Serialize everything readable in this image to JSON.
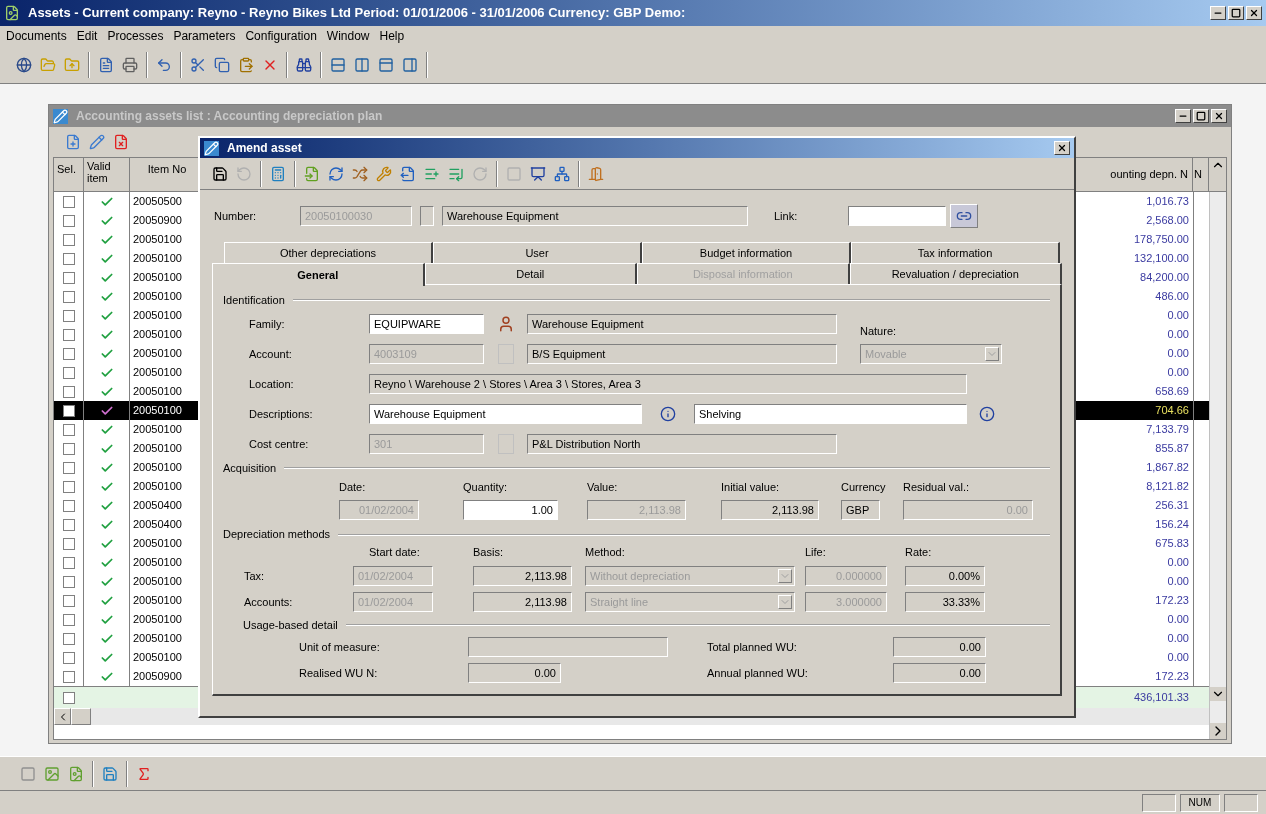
{
  "app": {
    "title": "Assets - Current company: Reyno - Reyno Bikes Ltd Period: 01/01/2006 - 31/01/2006 Currency: GBP Demo:"
  },
  "menu": [
    "Documents",
    "Edit",
    "Processes",
    "Parameters",
    "Configuration",
    "Window",
    "Help"
  ],
  "list_window": {
    "title": "Accounting assets list : Accounting depreciation plan",
    "columns": [
      "Sel.",
      "Valid item",
      "Item No",
      "ounting depn. N",
      "N"
    ],
    "rows": [
      {
        "checked": false,
        "valid": true,
        "selected": false,
        "item_no": "20050500",
        "amount": "1,016.73"
      },
      {
        "checked": false,
        "valid": true,
        "selected": false,
        "item_no": "20050900",
        "amount": "2,568.00"
      },
      {
        "checked": false,
        "valid": true,
        "selected": false,
        "item_no": "20050100",
        "amount": "178,750.00"
      },
      {
        "checked": false,
        "valid": true,
        "selected": false,
        "item_no": "20050100",
        "amount": "132,100.00"
      },
      {
        "checked": false,
        "valid": true,
        "selected": false,
        "item_no": "20050100",
        "amount": "84,200.00"
      },
      {
        "checked": false,
        "valid": true,
        "selected": false,
        "item_no": "20050100",
        "amount": "486.00"
      },
      {
        "checked": false,
        "valid": true,
        "selected": false,
        "item_no": "20050100",
        "amount": "0.00"
      },
      {
        "checked": false,
        "valid": true,
        "selected": false,
        "item_no": "20050100",
        "amount": "0.00"
      },
      {
        "checked": false,
        "valid": true,
        "selected": false,
        "item_no": "20050100",
        "amount": "0.00"
      },
      {
        "checked": false,
        "valid": true,
        "selected": false,
        "item_no": "20050100",
        "amount": "0.00"
      },
      {
        "checked": false,
        "valid": true,
        "selected": false,
        "item_no": "20050100",
        "amount": "658.69"
      },
      {
        "checked": false,
        "valid": true,
        "selected": true,
        "item_no": "20050100",
        "amount": "704.66"
      },
      {
        "checked": false,
        "valid": true,
        "selected": false,
        "item_no": "20050100",
        "amount": "7,133.79"
      },
      {
        "checked": false,
        "valid": true,
        "selected": false,
        "item_no": "20050100",
        "amount": "855.87"
      },
      {
        "checked": false,
        "valid": true,
        "selected": false,
        "item_no": "20050100",
        "amount": "1,867.82"
      },
      {
        "checked": false,
        "valid": true,
        "selected": false,
        "item_no": "20050100",
        "amount": "8,121.82"
      },
      {
        "checked": false,
        "valid": true,
        "selected": false,
        "item_no": "20050400",
        "amount": "256.31"
      },
      {
        "checked": false,
        "valid": true,
        "selected": false,
        "item_no": "20050400",
        "amount": "156.24"
      },
      {
        "checked": false,
        "valid": true,
        "selected": false,
        "item_no": "20050100",
        "amount": "675.83"
      },
      {
        "checked": false,
        "valid": true,
        "selected": false,
        "item_no": "20050100",
        "amount": "0.00"
      },
      {
        "checked": false,
        "valid": true,
        "selected": false,
        "item_no": "20050100",
        "amount": "0.00"
      },
      {
        "checked": false,
        "valid": true,
        "selected": false,
        "item_no": "20050100",
        "amount": "172.23"
      },
      {
        "checked": false,
        "valid": true,
        "selected": false,
        "item_no": "20050100",
        "amount": "0.00"
      },
      {
        "checked": false,
        "valid": true,
        "selected": false,
        "item_no": "20050100",
        "amount": "0.00"
      },
      {
        "checked": false,
        "valid": true,
        "selected": false,
        "item_no": "20050100",
        "amount": "0.00"
      },
      {
        "checked": false,
        "valid": true,
        "selected": false,
        "item_no": "20050900",
        "amount": "172.23"
      }
    ],
    "total": {
      "checked": false,
      "amount": "436,101.33"
    }
  },
  "dialog": {
    "title": "Amend asset",
    "number": {
      "label": "Number:",
      "code": {
        "kind": "disabled",
        "value": "20050100030"
      },
      "name": {
        "kind": "readonly",
        "value": "Warehouse Equipment"
      }
    },
    "link": {
      "label": "Link:",
      "field": {
        "kind": "input"
      }
    },
    "tab_rows": [
      [
        {
          "label": "Other depreciations",
          "selected": false,
          "disabled": false
        },
        {
          "label": "User",
          "selected": false,
          "disabled": false
        },
        {
          "label": "Budget information",
          "selected": false,
          "disabled": false
        },
        {
          "label": "Tax information",
          "selected": false,
          "disabled": false
        }
      ],
      [
        {
          "label": "General",
          "selected": true,
          "disabled": false
        },
        {
          "label": "Detail",
          "selected": false,
          "disabled": false
        },
        {
          "label": "Disposal information",
          "selected": false,
          "disabled": true
        },
        {
          "label": "Revaluation / depreciation",
          "selected": false,
          "disabled": false
        }
      ]
    ],
    "identification": {
      "title": "Identification",
      "family": {
        "label": "Family:",
        "code": {
          "kind": "input",
          "value": "EQUIPWARE"
        },
        "name": {
          "kind": "readonly",
          "value": "Warehouse Equipment"
        }
      },
      "nature": {
        "label": "Nature:",
        "field": {
          "kind": "disabled",
          "value": "Movable"
        }
      },
      "account": {
        "label": "Account:",
        "code": {
          "kind": "disabled",
          "value": "4003109"
        },
        "name": {
          "kind": "readonly",
          "value": "B/S Equipment"
        }
      },
      "location": {
        "label": "Location:",
        "field": {
          "kind": "readonly",
          "value": "Reyno \\ Warehouse 2 \\ Stores \\ Area 3  \\ Stores, Area 3"
        }
      },
      "descriptions": {
        "label": "Descriptions:",
        "first": {
          "kind": "input",
          "value": "Warehouse Equipment"
        },
        "second": {
          "kind": "input",
          "value": "Shelving"
        }
      },
      "cost_centre": {
        "label": "Cost centre:",
        "code": {
          "kind": "disabled",
          "value": "301"
        },
        "name": {
          "kind": "readonly",
          "value": "P&L Distribution North"
        }
      }
    },
    "acquisition": {
      "title": "Acquisition",
      "fields": [
        {
          "label": "Date:",
          "field": {
            "kind": "disabled",
            "value": "01/02/2004"
          }
        },
        {
          "label": "Quantity:",
          "field": {
            "kind": "input",
            "value": "1.00"
          }
        },
        {
          "label": "Value:",
          "field": {
            "kind": "disabled",
            "value": "2,113.98"
          }
        },
        {
          "label": "Initial value:",
          "field": {
            "kind": "readonly",
            "value": "2,113.98"
          }
        },
        {
          "label": "Currency",
          "field": {
            "kind": "readonly",
            "value": "GBP"
          }
        },
        {
          "label": "Residual val.:",
          "field": {
            "kind": "disabled",
            "value": "0.00"
          }
        }
      ]
    },
    "depreciation": {
      "title": "Depreciation methods",
      "columns": [
        "Start date:",
        "Basis:",
        "Method:",
        "Life:",
        "Rate:"
      ],
      "rows": [
        {
          "label": "Tax:",
          "start_date": {
            "kind": "disabled",
            "value": "01/02/2004"
          },
          "basis": {
            "kind": "readonly",
            "value": "2,113.98"
          },
          "method": {
            "kind": "disabled",
            "value": "Without depreciation"
          },
          "life": {
            "kind": "disabled",
            "value": "0.000000"
          },
          "rate": {
            "kind": "readonly",
            "value": "0.00%"
          }
        },
        {
          "label": "Accounts:",
          "start_date": {
            "kind": "disabled",
            "value": "01/02/2004"
          },
          "basis": {
            "kind": "readonly",
            "value": "2,113.98"
          },
          "method": {
            "kind": "disabled",
            "value": "Straight line"
          },
          "life": {
            "kind": "disabled",
            "value": "3.000000"
          },
          "rate": {
            "kind": "readonly",
            "value": "33.33%"
          }
        }
      ]
    },
    "usage": {
      "title": "Usage-based detail",
      "unit": {
        "label": "Unit of measure:",
        "field": {
          "kind": "readonly"
        }
      },
      "realised": {
        "label": "Realised WU N:",
        "field": {
          "kind": "readonly",
          "value": "0.00"
        }
      },
      "total_planned": {
        "label": "Total planned WU:",
        "field": {
          "kind": "readonly",
          "value": "0.00"
        }
      },
      "annual_planned": {
        "label": "Annual planned WU:",
        "field": {
          "kind": "readonly",
          "value": "0.00"
        }
      }
    }
  },
  "status_bar": {
    "indicator": "NUM"
  }
}
